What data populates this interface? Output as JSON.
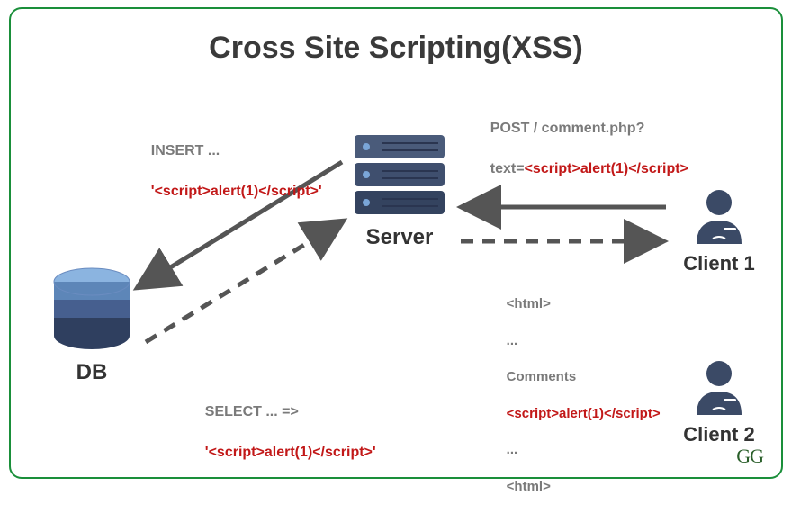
{
  "title": "Cross Site Scripting(XSS)",
  "nodes": {
    "db": "DB",
    "server": "Server",
    "client1": "Client 1",
    "client2": "Client 2"
  },
  "captions": {
    "insert_label": "INSERT ...",
    "insert_payload": "'<script>alert(1)</script>'",
    "select_label": "SELECT ... =>",
    "select_payload": "'<script>alert(1)</script>'",
    "post_line1": "POST / comment.php?",
    "post_prefix": "text=",
    "post_payload": "<script>alert(1)</script>",
    "html_open": "<html>",
    "html_dots1": "...",
    "html_comments": "Comments",
    "html_payload": "<script>alert(1)</script>",
    "html_dots2": "...",
    "html_close": "<html>"
  },
  "logo": "GG",
  "colors": {
    "border": "#1a8f3a",
    "server_dark": "#3b4a66",
    "server_mid": "#4a5b7a",
    "db_light": "#8bb4e0",
    "db_mid": "#5d86b8",
    "db_dark": "#3d5d8a",
    "client": "#3b4a66",
    "arrow": "#555"
  }
}
